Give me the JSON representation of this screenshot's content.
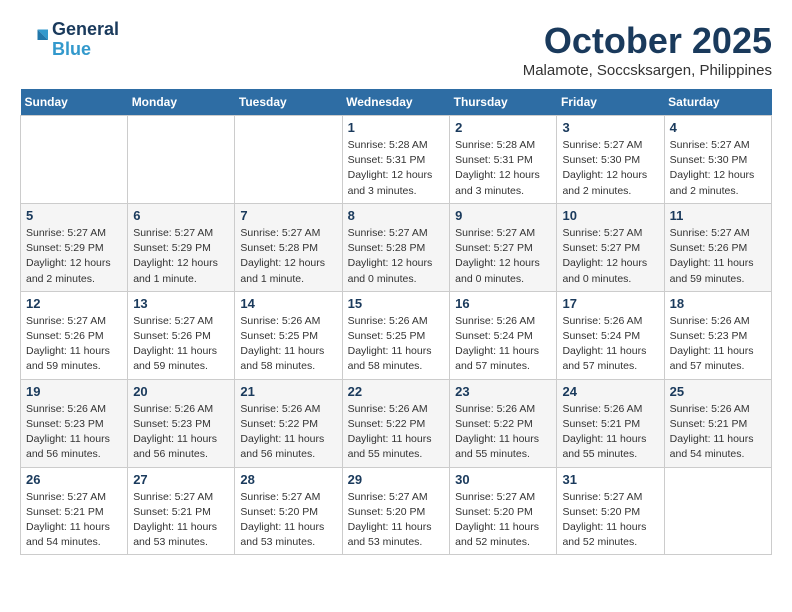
{
  "header": {
    "logo_line1": "General",
    "logo_line2": "Blue",
    "month_title": "October 2025",
    "subtitle": "Malamote, Soccsksargen, Philippines"
  },
  "weekdays": [
    "Sunday",
    "Monday",
    "Tuesday",
    "Wednesday",
    "Thursday",
    "Friday",
    "Saturday"
  ],
  "weeks": [
    [
      {
        "day": "",
        "info": ""
      },
      {
        "day": "",
        "info": ""
      },
      {
        "day": "",
        "info": ""
      },
      {
        "day": "1",
        "info": "Sunrise: 5:28 AM\nSunset: 5:31 PM\nDaylight: 12 hours\nand 3 minutes."
      },
      {
        "day": "2",
        "info": "Sunrise: 5:28 AM\nSunset: 5:31 PM\nDaylight: 12 hours\nand 3 minutes."
      },
      {
        "day": "3",
        "info": "Sunrise: 5:27 AM\nSunset: 5:30 PM\nDaylight: 12 hours\nand 2 minutes."
      },
      {
        "day": "4",
        "info": "Sunrise: 5:27 AM\nSunset: 5:30 PM\nDaylight: 12 hours\nand 2 minutes."
      }
    ],
    [
      {
        "day": "5",
        "info": "Sunrise: 5:27 AM\nSunset: 5:29 PM\nDaylight: 12 hours\nand 2 minutes."
      },
      {
        "day": "6",
        "info": "Sunrise: 5:27 AM\nSunset: 5:29 PM\nDaylight: 12 hours\nand 1 minute."
      },
      {
        "day": "7",
        "info": "Sunrise: 5:27 AM\nSunset: 5:28 PM\nDaylight: 12 hours\nand 1 minute."
      },
      {
        "day": "8",
        "info": "Sunrise: 5:27 AM\nSunset: 5:28 PM\nDaylight: 12 hours\nand 0 minutes."
      },
      {
        "day": "9",
        "info": "Sunrise: 5:27 AM\nSunset: 5:27 PM\nDaylight: 12 hours\nand 0 minutes."
      },
      {
        "day": "10",
        "info": "Sunrise: 5:27 AM\nSunset: 5:27 PM\nDaylight: 12 hours\nand 0 minutes."
      },
      {
        "day": "11",
        "info": "Sunrise: 5:27 AM\nSunset: 5:26 PM\nDaylight: 11 hours\nand 59 minutes."
      }
    ],
    [
      {
        "day": "12",
        "info": "Sunrise: 5:27 AM\nSunset: 5:26 PM\nDaylight: 11 hours\nand 59 minutes."
      },
      {
        "day": "13",
        "info": "Sunrise: 5:27 AM\nSunset: 5:26 PM\nDaylight: 11 hours\nand 59 minutes."
      },
      {
        "day": "14",
        "info": "Sunrise: 5:26 AM\nSunset: 5:25 PM\nDaylight: 11 hours\nand 58 minutes."
      },
      {
        "day": "15",
        "info": "Sunrise: 5:26 AM\nSunset: 5:25 PM\nDaylight: 11 hours\nand 58 minutes."
      },
      {
        "day": "16",
        "info": "Sunrise: 5:26 AM\nSunset: 5:24 PM\nDaylight: 11 hours\nand 57 minutes."
      },
      {
        "day": "17",
        "info": "Sunrise: 5:26 AM\nSunset: 5:24 PM\nDaylight: 11 hours\nand 57 minutes."
      },
      {
        "day": "18",
        "info": "Sunrise: 5:26 AM\nSunset: 5:23 PM\nDaylight: 11 hours\nand 57 minutes."
      }
    ],
    [
      {
        "day": "19",
        "info": "Sunrise: 5:26 AM\nSunset: 5:23 PM\nDaylight: 11 hours\nand 56 minutes."
      },
      {
        "day": "20",
        "info": "Sunrise: 5:26 AM\nSunset: 5:23 PM\nDaylight: 11 hours\nand 56 minutes."
      },
      {
        "day": "21",
        "info": "Sunrise: 5:26 AM\nSunset: 5:22 PM\nDaylight: 11 hours\nand 56 minutes."
      },
      {
        "day": "22",
        "info": "Sunrise: 5:26 AM\nSunset: 5:22 PM\nDaylight: 11 hours\nand 55 minutes."
      },
      {
        "day": "23",
        "info": "Sunrise: 5:26 AM\nSunset: 5:22 PM\nDaylight: 11 hours\nand 55 minutes."
      },
      {
        "day": "24",
        "info": "Sunrise: 5:26 AM\nSunset: 5:21 PM\nDaylight: 11 hours\nand 55 minutes."
      },
      {
        "day": "25",
        "info": "Sunrise: 5:26 AM\nSunset: 5:21 PM\nDaylight: 11 hours\nand 54 minutes."
      }
    ],
    [
      {
        "day": "26",
        "info": "Sunrise: 5:27 AM\nSunset: 5:21 PM\nDaylight: 11 hours\nand 54 minutes."
      },
      {
        "day": "27",
        "info": "Sunrise: 5:27 AM\nSunset: 5:21 PM\nDaylight: 11 hours\nand 53 minutes."
      },
      {
        "day": "28",
        "info": "Sunrise: 5:27 AM\nSunset: 5:20 PM\nDaylight: 11 hours\nand 53 minutes."
      },
      {
        "day": "29",
        "info": "Sunrise: 5:27 AM\nSunset: 5:20 PM\nDaylight: 11 hours\nand 53 minutes."
      },
      {
        "day": "30",
        "info": "Sunrise: 5:27 AM\nSunset: 5:20 PM\nDaylight: 11 hours\nand 52 minutes."
      },
      {
        "day": "31",
        "info": "Sunrise: 5:27 AM\nSunset: 5:20 PM\nDaylight: 11 hours\nand 52 minutes."
      },
      {
        "day": "",
        "info": ""
      }
    ]
  ]
}
